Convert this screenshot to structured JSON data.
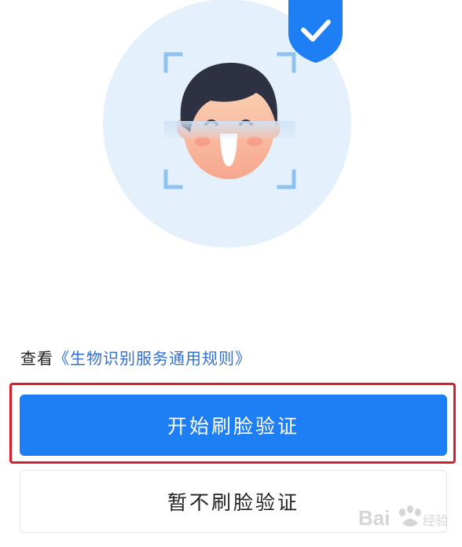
{
  "terms": {
    "prefix": "查看",
    "link_label": "《生物识别服务通用规则》"
  },
  "buttons": {
    "start_label": "开始刷脸验证",
    "skip_label": "暂不刷脸验证"
  },
  "icons": {
    "illustration": "face-scan-illustration",
    "badge": "shield-check-icon"
  },
  "colors": {
    "primary": "#1e7ff5",
    "link": "#2f6fd8",
    "circle_bg": "#e4f0fb",
    "highlight": "#d2202f"
  },
  "watermark": {
    "text": "Bai 经验"
  }
}
